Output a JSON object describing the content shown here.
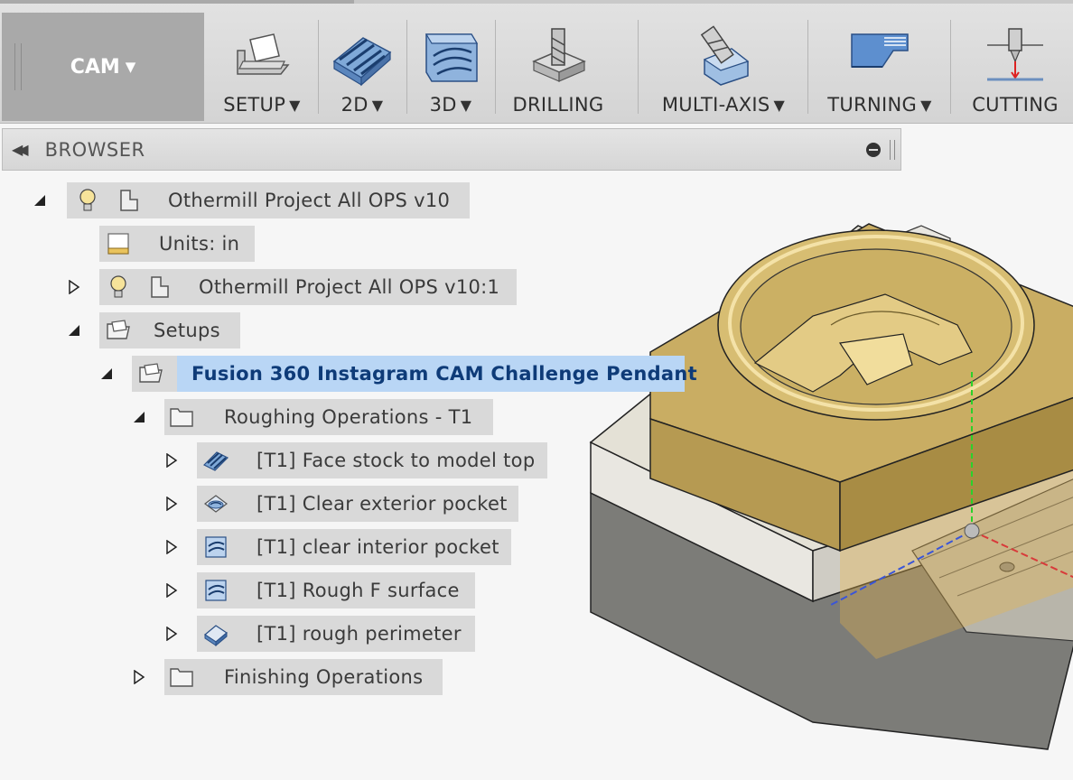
{
  "toolbar": {
    "workspace_label": "CAM",
    "groups": [
      {
        "label": "SETUP",
        "icon": "setup-icon",
        "dropdown": true
      },
      {
        "label": "2D",
        "icon": "2d-milling-icon",
        "dropdown": true
      },
      {
        "label": "3D",
        "icon": "3d-milling-icon",
        "dropdown": true
      },
      {
        "label": "DRILLING",
        "icon": "drill-icon",
        "dropdown": false
      },
      {
        "label": "MULTI-AXIS",
        "icon": "multi-axis-icon",
        "dropdown": true
      },
      {
        "label": "TURNING",
        "icon": "turning-icon",
        "dropdown": true
      },
      {
        "label": "CUTTING",
        "icon": "cutting-icon",
        "dropdown": false
      }
    ]
  },
  "browser": {
    "title": "BROWSER",
    "tree": {
      "root": "Othermill Project All OPS v10",
      "units": "Units: in",
      "component": "Othermill Project All OPS v10:1",
      "setups": "Setups",
      "setup": "Fusion 360 Instagram CAM Challenge Pendant",
      "roughing": "Roughing Operations - T1",
      "operations": [
        "[T1] Face stock to model top",
        "[T1] Clear exterior pocket",
        "[T1] clear interior pocket",
        "[T1] Rough F surface",
        "[T1] rough perimeter"
      ],
      "finishing": "Finishing Operations"
    }
  },
  "colors": {
    "selection": "#b9d6f5",
    "selected_text": "#0e3b78",
    "part_gold": "#cdb068",
    "toolpath_blue": "#3a6fb5"
  }
}
